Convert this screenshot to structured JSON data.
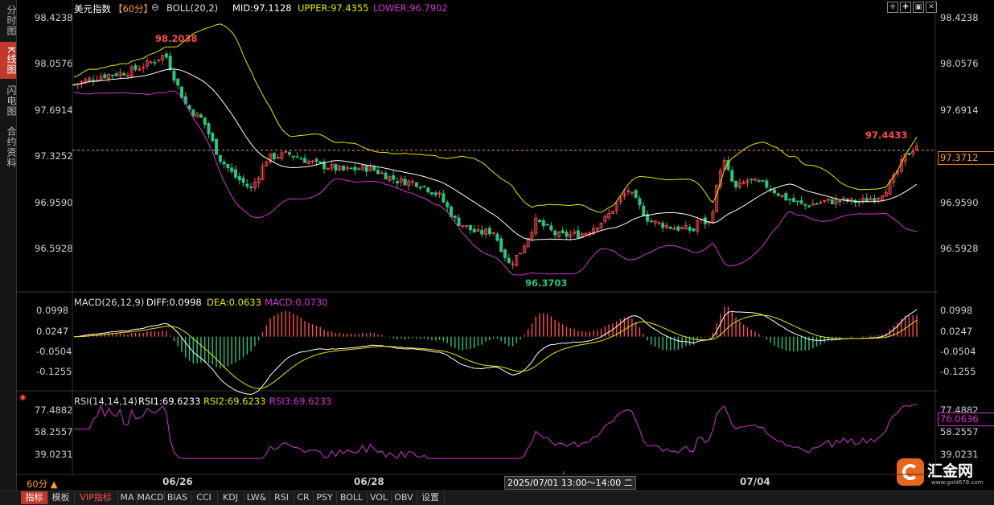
{
  "sidebar": {
    "items": [
      {
        "label": "分时图",
        "active": false
      },
      {
        "label": "K线图",
        "active": true
      },
      {
        "label": "闪电图",
        "active": false
      },
      {
        "label": "合约资料",
        "active": false
      }
    ]
  },
  "header": {
    "symbol": "美元指数",
    "period": "【60分】",
    "boll": "BOLL(20,2)",
    "mid": "MID:97.1128",
    "upper": "UPPER:97.4355",
    "lower": "LOWER:96.7902",
    "controls": [
      "✛",
      "✚",
      "▣",
      "✕"
    ]
  },
  "macd_header": {
    "name": "MACD(26,12,9)",
    "diff": "DIFF:0.0998",
    "dea": "DEA:0.0633",
    "macd": "MACD:0.0730"
  },
  "rsi_header": {
    "name": "RSI(14,14,14)",
    "rsi1": "RSI1:69.6233",
    "rsi2": "RSI2:69.6233",
    "rsi3": "RSI3:69.6233"
  },
  "price_axis": {
    "left": [
      "98.4238",
      "98.0576",
      "97.6914",
      "97.3252",
      "96.9590",
      "96.5928"
    ],
    "right": [
      "98.4238",
      "98.0576",
      "97.6914",
      "97.3252",
      "96.9590",
      "96.5928"
    ],
    "current": "97.3712"
  },
  "macd_axis": [
    "0.0998",
    "0.0247",
    "-0.0504",
    "-0.1255"
  ],
  "rsi_axis": [
    "77.4882",
    "58.2557",
    "39.0231"
  ],
  "rsi_current": "76.0636",
  "annotations": {
    "high": "98.2038",
    "low": "96.3703",
    "recent_high": "97.4433"
  },
  "x_axis": {
    "ticks": [
      "06/26",
      "06/28",
      "07/04"
    ],
    "cursor": "2025/07/01 13:00～14:00 二"
  },
  "period_label": "60分 ▲",
  "tabs": [
    {
      "label": "指标",
      "active": true
    },
    {
      "label": "模板",
      "active": false
    },
    {
      "label": "VIP指标",
      "active": false,
      "vip": true
    },
    {
      "label": "MA"
    },
    {
      "label": "MACD"
    },
    {
      "label": "BIAS"
    },
    {
      "label": "CCI"
    },
    {
      "label": "KDJ"
    },
    {
      "label": "LW&"
    },
    {
      "label": "RSI"
    },
    {
      "label": "CR"
    },
    {
      "label": "PSY"
    },
    {
      "label": "BOLL"
    },
    {
      "label": "VOL"
    },
    {
      "label": "OBV"
    },
    {
      "label": "设置"
    }
  ],
  "logo": {
    "name": "汇金网",
    "url": "www.gold678.com"
  },
  "colors": {
    "up": "#ff4d4d",
    "down": "#2ec27e",
    "mid": "#ffffff",
    "upper": "#e6e600",
    "lower": "#d233d2",
    "price": "#ff9c2a"
  }
}
